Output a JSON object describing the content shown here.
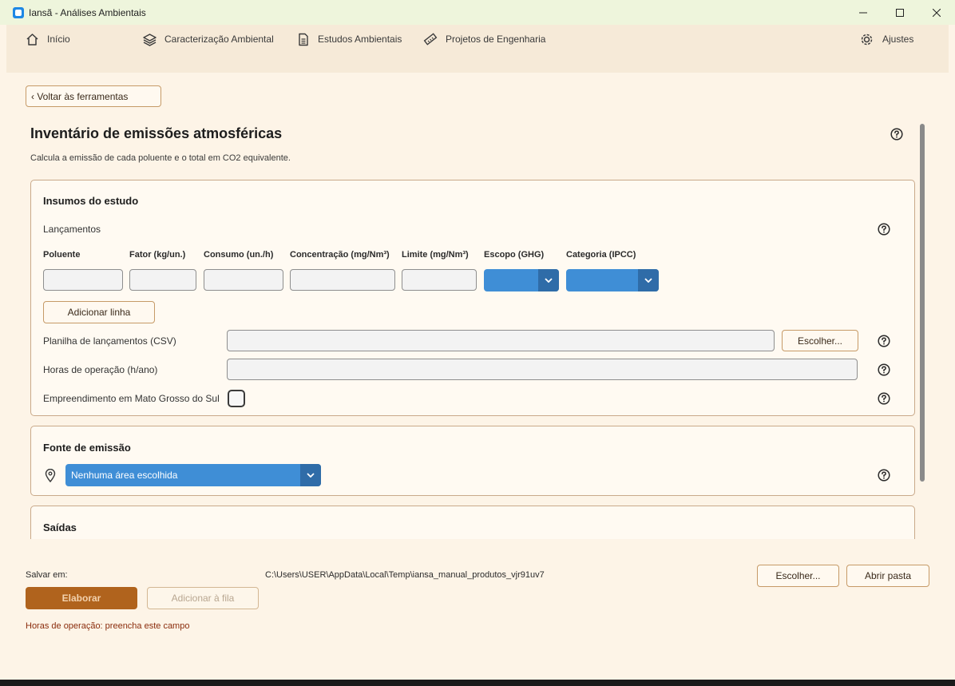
{
  "window": {
    "title": "Iansã - Análises Ambientais",
    "controls": {
      "minimize": "—",
      "maximize": "☐",
      "close": "✕"
    }
  },
  "nav": {
    "items": [
      {
        "label": "Início",
        "icon": "home-icon"
      },
      {
        "label": "Caracterização Ambiental",
        "icon": "layers-icon"
      },
      {
        "label": "Estudos Ambientais",
        "icon": "document-icon"
      },
      {
        "label": "Projetos de Engenharia",
        "icon": "ruler-icon"
      }
    ],
    "settings": {
      "label": "Ajustes",
      "icon": "gear-icon"
    }
  },
  "page": {
    "back_label": "‹ Voltar às ferramentas",
    "title": "Inventário de emissões atmosféricas",
    "subtitle": "Calcula a emissão de cada poluente e o total em CO2 equivalente."
  },
  "inputs_panel": {
    "title": "Insumos do estudo",
    "releases_label": "Lançamentos",
    "columns": [
      "Poluente",
      "Fator (kg/un.)",
      "Consumo (un./h)",
      "Concentração (mg/Nm³)",
      "Limite (mg/Nm³)",
      "Escopo (GHG)",
      "Categoria (IPCC)"
    ],
    "add_row_label": "Adicionar linha",
    "csv_label": "Planilha de lançamentos (CSV)",
    "csv_value": "",
    "choose_label": "Escolher...",
    "hours_label": "Horas de operação (h/ano)",
    "hours_value": "",
    "ms_label": "Empreendimento em Mato Grosso do Sul",
    "ms_checked": false
  },
  "source_panel": {
    "title": "Fonte de emissão",
    "area_value": "Nenhuma área escolhida"
  },
  "outputs_panel": {
    "title": "Saídas"
  },
  "footer": {
    "save_label": "Salvar em:",
    "save_path": "C:\\Users\\USER\\AppData\\Local\\Temp\\iansa_manual_produtos_vjr91uv7",
    "choose_label": "Escolher...",
    "open_folder_label": "Abrir pasta",
    "run_label": "Elaborar",
    "queue_label": "Adicionar à fila",
    "error_message": "Horas de operação: preencha este campo"
  },
  "colors": {
    "accent": "#b0631d",
    "dropdown": "#3f8ed6",
    "background": "#fdf4e7",
    "error": "#8a2c0c"
  }
}
